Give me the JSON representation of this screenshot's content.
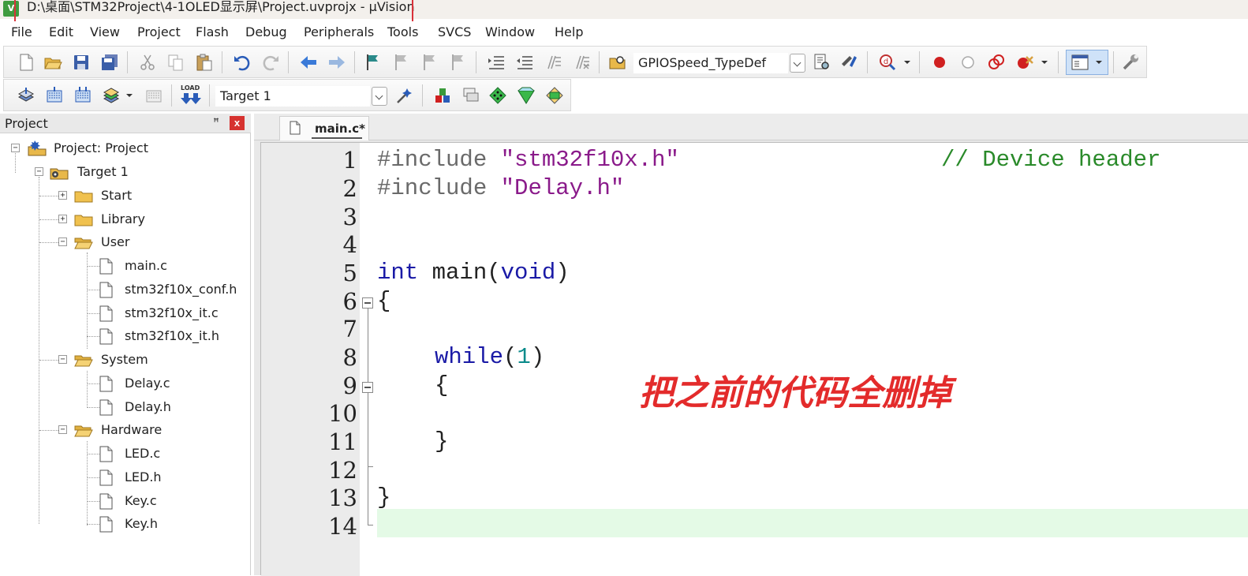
{
  "window": {
    "title": "D:\\桌面\\STM32Project\\4-1OLED显示屏\\Project.uvprojx - µVision",
    "app_icon_label": "V"
  },
  "menu": [
    "File",
    "Edit",
    "View",
    "Project",
    "Flash",
    "Debug",
    "Peripherals",
    "Tools",
    "SVCS",
    "Window",
    "Help"
  ],
  "toolbar1": {
    "find_combo_value": "GPIOSpeed_TypeDef"
  },
  "toolbar2": {
    "target_combo_value": "Target 1",
    "load_label": "LOAD"
  },
  "project_panel": {
    "title": "Project",
    "pin_glyph": "ꟸ",
    "close_glyph": "x",
    "tree": [
      {
        "label": "Project: Project",
        "kind": "project",
        "toggle": "−"
      },
      {
        "label": "Target 1",
        "kind": "target",
        "toggle": "−"
      },
      {
        "label": "Start",
        "kind": "folder",
        "toggle": "+"
      },
      {
        "label": "Library",
        "kind": "folder",
        "toggle": "+"
      },
      {
        "label": "User",
        "kind": "folder-open",
        "toggle": "−"
      },
      {
        "label": "main.c",
        "kind": "file"
      },
      {
        "label": "stm32f10x_conf.h",
        "kind": "file"
      },
      {
        "label": "stm32f10x_it.c",
        "kind": "file"
      },
      {
        "label": "stm32f10x_it.h",
        "kind": "file"
      },
      {
        "label": "System",
        "kind": "folder-open",
        "toggle": "−"
      },
      {
        "label": "Delay.c",
        "kind": "file"
      },
      {
        "label": "Delay.h",
        "kind": "file"
      },
      {
        "label": "Hardware",
        "kind": "folder-open",
        "toggle": "−"
      },
      {
        "label": "LED.c",
        "kind": "file"
      },
      {
        "label": "LED.h",
        "kind": "file"
      },
      {
        "label": "Key.c",
        "kind": "file"
      },
      {
        "label": "Key.h",
        "kind": "file"
      }
    ]
  },
  "editor": {
    "tab_label": "main.c*",
    "line_numbers": [
      "1",
      "2",
      "3",
      "4",
      "5",
      "6",
      "7",
      "8",
      "9",
      "10",
      "11",
      "12",
      "13",
      "14"
    ],
    "code": {
      "l1_directive": "#include ",
      "l1_string": "\"stm32f10x.h\"",
      "l1_comment": "// Device header",
      "l2_directive": "#include ",
      "l2_string": "\"Delay.h\"",
      "l5_kw_int": "int",
      "l5_main": " main(",
      "l5_kw_void": "void",
      "l5_close": ")",
      "l6": "{",
      "l8_kw_while": "while",
      "l8_open": "(",
      "l8_num": "1",
      "l8_close": ")",
      "l9": "{",
      "l11": "}",
      "l13": "}"
    }
  },
  "annotation": "把之前的代码全删掉",
  "colors": {
    "keyword": "#1a1aa6",
    "string": "#8a1a8a",
    "comment": "#2a8a2a",
    "number": "#0a8a8a",
    "annotation": "#e32b2b",
    "highlight_box": "#d9323a",
    "current_line": "#e4fae6"
  }
}
